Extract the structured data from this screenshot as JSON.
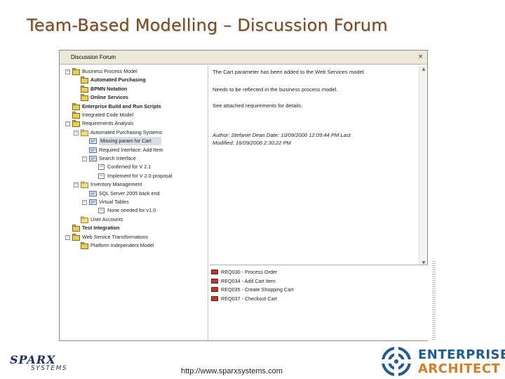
{
  "slide": {
    "title": "Team-Based Modelling – Discussion Forum",
    "footer_url": "http://www.sparxsystems.com"
  },
  "window": {
    "title": "Discussion Forum",
    "close_glyph": "×"
  },
  "tree": [
    {
      "label": "Business Process Model",
      "level": 0,
      "expander": "−",
      "icon": "package-icon",
      "bold": false,
      "selected": false
    },
    {
      "label": "Automated Purchasing",
      "level": 1,
      "expander": "",
      "icon": "package-icon",
      "bold": true,
      "selected": false
    },
    {
      "label": "BPMN Notation",
      "level": 1,
      "expander": "",
      "icon": "package-icon",
      "bold": true,
      "selected": false
    },
    {
      "label": "Online Services",
      "level": 1,
      "expander": "",
      "icon": "package-icon",
      "bold": true,
      "selected": false
    },
    {
      "label": "Enterprise Build and Run Scripts",
      "level": 0,
      "expander": "",
      "icon": "package-icon",
      "bold": true,
      "selected": false
    },
    {
      "label": "Integrated Code Model",
      "level": 0,
      "expander": "",
      "icon": "package-icon",
      "bold": false,
      "selected": false
    },
    {
      "label": "Requirements Analysis",
      "level": 0,
      "expander": "−",
      "icon": "package-icon",
      "bold": false,
      "selected": false
    },
    {
      "label": "Automated Purchasing Systems",
      "level": 1,
      "expander": "−",
      "icon": "folder-icon",
      "bold": false,
      "selected": false
    },
    {
      "label": "Missing param for Cart",
      "level": 2,
      "expander": "",
      "icon": "topic-icon",
      "bold": false,
      "selected": true
    },
    {
      "label": "Required Interface: Add Item",
      "level": 2,
      "expander": "",
      "icon": "topic-icon",
      "bold": false,
      "selected": false
    },
    {
      "label": "Search Interface",
      "level": 2,
      "expander": "−",
      "icon": "topic-icon",
      "bold": false,
      "selected": false
    },
    {
      "label": "Confirmed for V 2.1",
      "level": 3,
      "expander": "",
      "icon": "reply-icon",
      "bold": false,
      "selected": false
    },
    {
      "label": "Implement for V 2.0 proposal",
      "level": 3,
      "expander": "",
      "icon": "reply-icon",
      "bold": false,
      "selected": false
    },
    {
      "label": "Inventory Management",
      "level": 1,
      "expander": "−",
      "icon": "folder-icon",
      "bold": false,
      "selected": false
    },
    {
      "label": "SQL Server 2005 back end",
      "level": 2,
      "expander": "",
      "icon": "topic-icon",
      "bold": false,
      "selected": false
    },
    {
      "label": "Virtual Tables",
      "level": 2,
      "expander": "−",
      "icon": "topic-icon",
      "bold": false,
      "selected": false
    },
    {
      "label": "None needed for v1.0",
      "level": 3,
      "expander": "",
      "icon": "reply-icon",
      "bold": false,
      "selected": false
    },
    {
      "label": "User Accounts",
      "level": 1,
      "expander": "",
      "icon": "folder-icon",
      "bold": false,
      "selected": false
    },
    {
      "label": "Test Integration",
      "level": 0,
      "expander": "",
      "icon": "package-icon",
      "bold": true,
      "selected": false
    },
    {
      "label": "Web Service Transformations",
      "level": 0,
      "expander": "−",
      "icon": "package-icon",
      "bold": false,
      "selected": false
    },
    {
      "label": "Platform Independent Model",
      "level": 1,
      "expander": "",
      "icon": "package-icon",
      "bold": false,
      "selected": false
    }
  ],
  "message": {
    "line1": "The Cart parameter has been added to the Web Services model.",
    "line2": "Needs to be reflected in the business process model.",
    "line3": "See attached requirements for details.",
    "meta1": "Author: Stefanie Dean     Date: 10/09/2006 12:09:44 PM     Last",
    "meta2": "Modified: 16/09/2006 2:30:22 PM"
  },
  "attachments": [
    {
      "label": "REQ030 - Process Order",
      "icon": "requirement-icon"
    },
    {
      "label": "REQ034 - Add Cart Item",
      "icon": "requirement-icon"
    },
    {
      "label": "REQ035 - Create Shopping Cart",
      "icon": "requirement-icon"
    },
    {
      "label": "REQ037 - Checkout Cart",
      "icon": "requirement-icon"
    }
  ],
  "branding": {
    "sparx": "SPARX",
    "systems": "SYSTEMS",
    "ea_line1": "ENTERPRISE",
    "ea_line2": "ARCHITECT",
    "colors": {
      "title": "#7a4a22",
      "sparx_blue": "#1c2f6e",
      "ea_blue": "#1c5c9c",
      "ea_orange": "#e07a1e"
    }
  }
}
